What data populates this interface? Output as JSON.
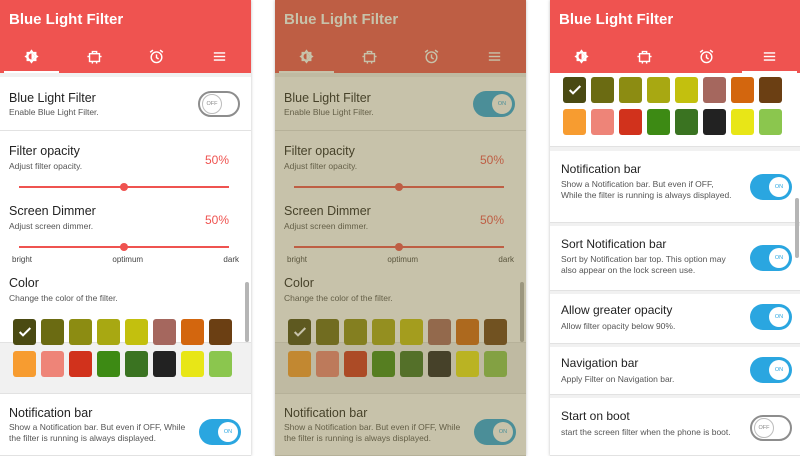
{
  "app": {
    "title": "Blue Light Filter"
  },
  "tabs": [
    {
      "icon": "brightness-icon"
    },
    {
      "icon": "shop-icon"
    },
    {
      "icon": "alarm-clock-icon"
    },
    {
      "icon": "menu-icon"
    }
  ],
  "settings": {
    "blue_light": {
      "title": "Blue Light Filter",
      "desc": "Enable Blue Light Filter.",
      "off_label": "OFF",
      "on_label": "ON"
    },
    "filter_opacity": {
      "title": "Filter opacity",
      "desc": "Adjust filter opacity.",
      "value": "50%",
      "level": 0.5
    },
    "screen_dimmer": {
      "title": "Screen Dimmer",
      "desc": "Adjust screen dimmer.",
      "value": "50%",
      "level": 0.5,
      "labels": [
        "bright",
        "optimum",
        "dark"
      ]
    },
    "color": {
      "title": "Color",
      "desc": "Change the color of the filter."
    },
    "notification_bar": {
      "title": "Notification bar",
      "desc": "Show a Notification bar. But even if OFF, While the filter is running is always displayed.",
      "state": "ON"
    },
    "sort_notification": {
      "title": "Sort Notification bar",
      "desc": "Sort by Notification bar top. This option may also appear on the lock screen use.",
      "state": "ON"
    },
    "greater_opacity": {
      "title": "Allow greater opacity",
      "desc": "Allow filter opacity below 90%.",
      "state": "ON"
    },
    "navigation_bar": {
      "title": "Navigation bar",
      "desc": "Apply Filter on Navigation bar.",
      "state": "ON"
    },
    "start_on_boot": {
      "title": "Start on boot",
      "desc": "start the screen filter when the phone is boot.",
      "state": "OFF"
    }
  },
  "colors": [
    "#4a4a12",
    "#6b6b12",
    "#8c8c12",
    "#a8a812",
    "#c3c00e",
    "#a5675e",
    "#d3660e",
    "#6b3f13",
    "#f79c30",
    "#ee8478",
    "#d1321c",
    "#3d8a14",
    "#3a7321",
    "#222222",
    "#e8e617",
    "#8bc64e"
  ],
  "theme": {
    "primary": "#ef5350",
    "accent": "#2aa6e0"
  }
}
